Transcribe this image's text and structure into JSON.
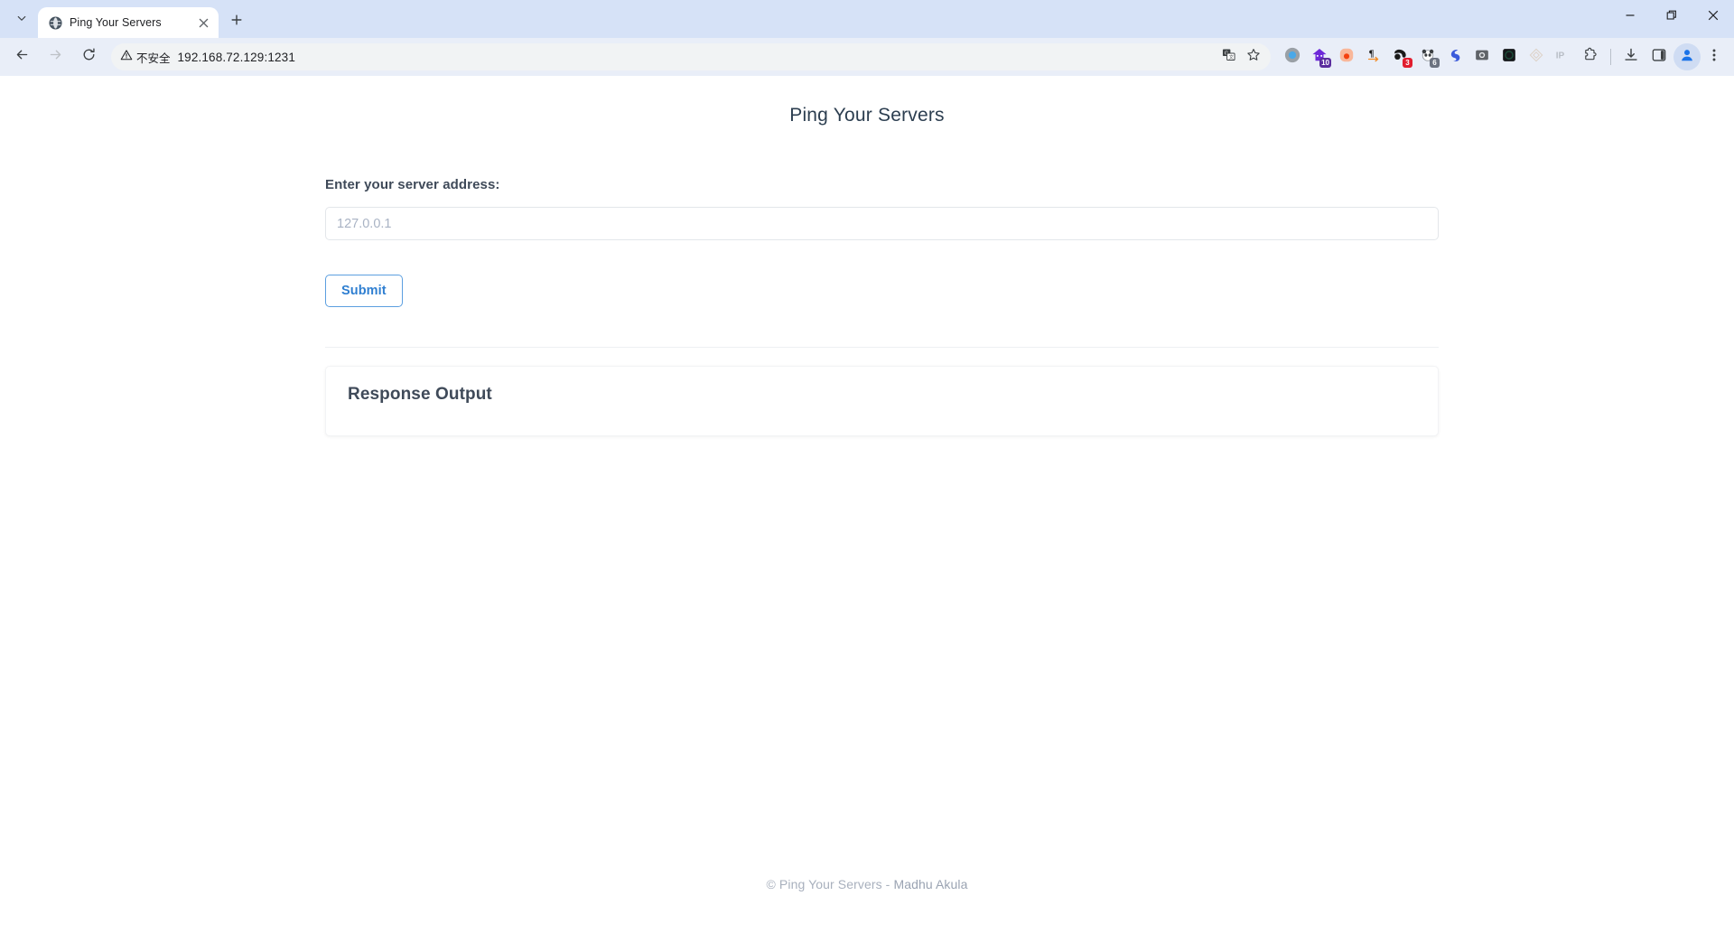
{
  "browser": {
    "tab_list_icon": "chevron-down-icon",
    "tab": {
      "favicon": "globe-icon",
      "title": "Ping Your Servers",
      "close_icon": "close-icon"
    },
    "new_tab_icon": "plus-icon",
    "window_controls": {
      "minimize": "minimize-icon",
      "maximize": "restore-icon",
      "close": "close-icon"
    },
    "toolbar": {
      "back_icon": "back-arrow-icon",
      "forward_icon": "forward-arrow-icon",
      "reload_icon": "reload-icon",
      "security_icon": "warning-triangle-icon",
      "security_label": "不安全",
      "url": "192.168.72.129:1231",
      "translate_icon": "translate-icon",
      "bookmark_icon": "star-icon",
      "extensions": [
        {
          "name": "ext-circle-blue",
          "badge": ""
        },
        {
          "name": "ext-purple-house",
          "badge": "10",
          "badge_color": "#5b2d9e"
        },
        {
          "name": "ext-orange-blob",
          "badge": ""
        },
        {
          "name": "ext-pilcrow-arrow",
          "badge": ""
        },
        {
          "name": "ext-black-red",
          "badge": "3",
          "badge_color": "#e11d2e"
        },
        {
          "name": "ext-panda",
          "badge": "6",
          "badge_color": "#6b7280"
        },
        {
          "name": "ext-blue-swirl",
          "badge": ""
        },
        {
          "name": "ext-camera-gray",
          "badge": ""
        },
        {
          "name": "ext-dark-square",
          "badge": ""
        },
        {
          "name": "ext-diamond-outline",
          "badge": ""
        },
        {
          "name": "ext-ip-label",
          "badge": "",
          "label": "IP"
        },
        {
          "name": "ext-puzzle-piece",
          "badge": ""
        }
      ],
      "downloads_icon": "download-icon",
      "side_panel_icon": "side-panel-icon",
      "profile_icon": "avatar-icon",
      "menu_icon": "three-dot-menu-icon"
    }
  },
  "page": {
    "title": "Ping Your Servers",
    "form": {
      "label": "Enter your server address:",
      "input_value": "",
      "input_placeholder": "127.0.0.1",
      "submit_label": "Submit"
    },
    "response": {
      "heading": "Response Output",
      "body": ""
    },
    "footer": {
      "copyright": "© Ping Your Servers - ",
      "author": "Madhu Akula"
    }
  },
  "colors": {
    "accent_blue": "#2f7fd1",
    "title_navy": "#2c3e50",
    "label_slate": "#3f4a59",
    "footer_gray": "#a8b0bd",
    "chrome_tabstrip": "#d6e2f7",
    "chrome_toolbar": "#e9eef8"
  }
}
